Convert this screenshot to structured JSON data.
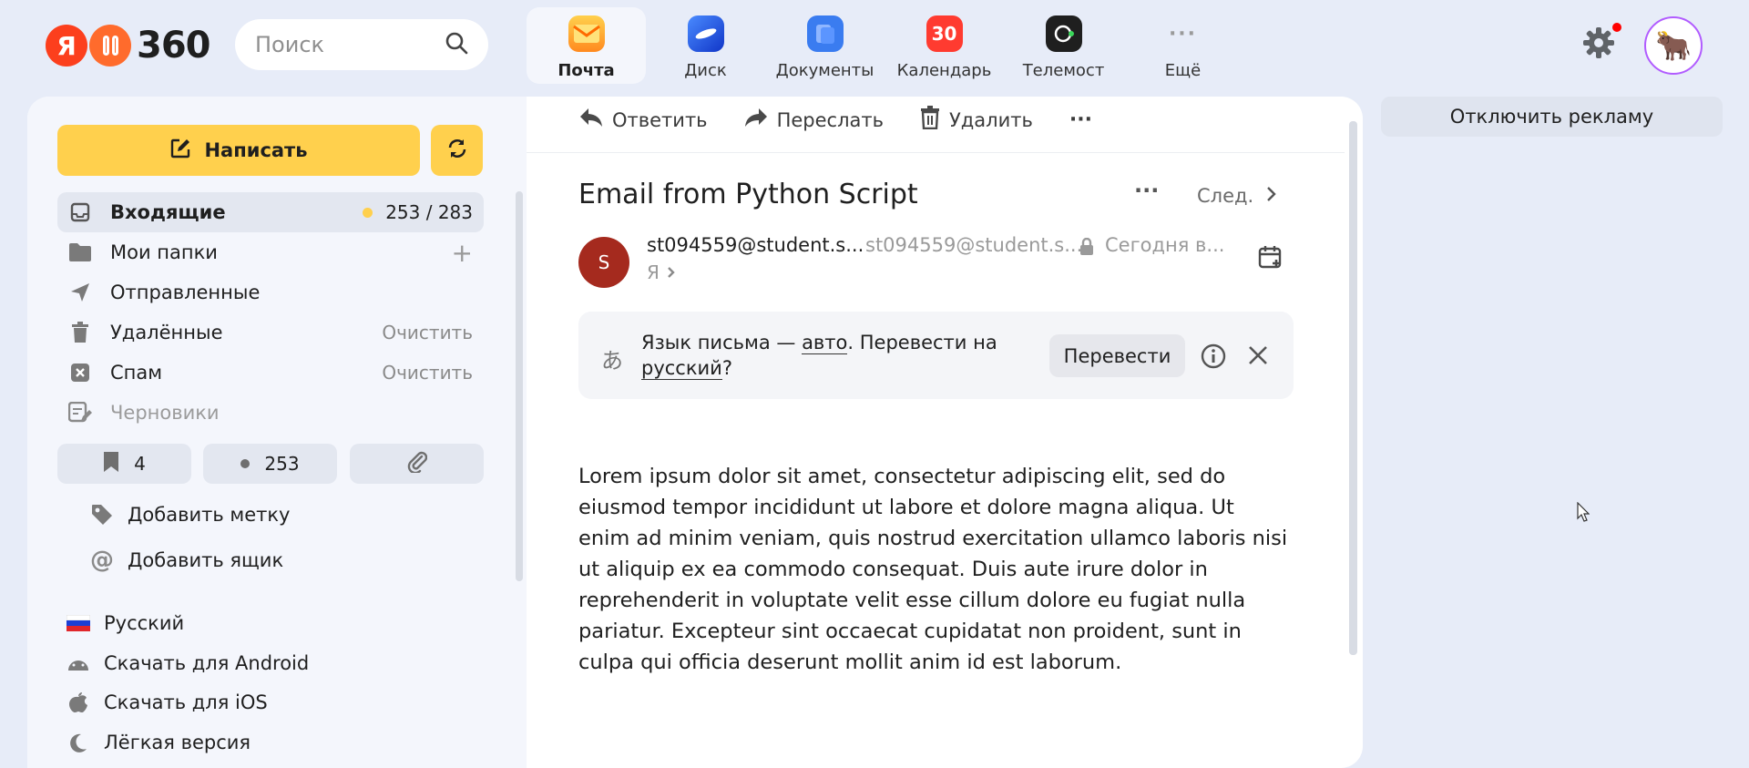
{
  "header": {
    "logo_number": "360",
    "search_placeholder": "Поиск",
    "services": [
      {
        "label": "Почта",
        "icon": "mail-icon",
        "color": "#ffb300"
      },
      {
        "label": "Диск",
        "icon": "disk-icon",
        "color": "#1f5fe0"
      },
      {
        "label": "Документы",
        "icon": "documents-icon",
        "color": "#3a7cf0"
      },
      {
        "label": "Календарь",
        "icon": "calendar-icon",
        "color": "#ff3b30",
        "badge": "30"
      },
      {
        "label": "Телемост",
        "icon": "telemost-icon",
        "color": "#1f1f1f"
      },
      {
        "label": "Ещё",
        "icon": "more-icon",
        "color": "#9a9a9a"
      }
    ]
  },
  "sidebar": {
    "compose_label": "Написать",
    "folders": [
      {
        "label": "Входящие",
        "icon": "inbox-icon",
        "count": "253 / 283"
      },
      {
        "label": "Мои папки",
        "icon": "folder-icon"
      },
      {
        "label": "Отправленные",
        "icon": "sent-icon"
      },
      {
        "label": "Удалённые",
        "icon": "trash-icon",
        "action": "Очистить"
      },
      {
        "label": "Спам",
        "icon": "spam-icon",
        "action": "Очистить"
      },
      {
        "label": "Черновики",
        "icon": "drafts-icon"
      }
    ],
    "filters": {
      "bookmarks": "4",
      "unread": "253"
    },
    "add_label": "Добавить метку",
    "add_mailbox": "Добавить ящик",
    "language": "Русский",
    "download_android": "Скачать для Android",
    "download_ios": "Скачать для iOS",
    "light_version": "Лёгкая версия"
  },
  "toolbar": {
    "reply": "Ответить",
    "forward": "Переслать",
    "delete": "Удалить",
    "more": "···"
  },
  "email": {
    "subject": "Email from Python Script",
    "more": "···",
    "next": "След.",
    "sender_initial": "S",
    "sender_name": "st094559@student.s...",
    "sender_email": "st094559@student.s...",
    "date": "Сегодня в...",
    "to": "Я",
    "translate": {
      "text_before": "Язык письма — ",
      "auto": "авто",
      "text_mid": ". Перевести на ",
      "language": "русский",
      "text_after": "?",
      "button": "Перевести"
    },
    "body": "Lorem ipsum dolor sit amet, consectetur adipiscing elit, sed do eiusmod tempor incididunt ut labore et dolore magna aliqua. Ut enim ad minim veniam, quis nostrud exercitation ullamco laboris nisi ut aliquip ex ea commodo consequat. Duis aute irure dolor in reprehenderit in voluptate velit esse cillum dolore eu fugiat nulla pariatur. Excepteur sint occaecat cupidatat non proident, sunt in culpa qui officia deserunt mollit anim id est laborum."
  },
  "ads": {
    "disable": "Отключить рекламу"
  }
}
